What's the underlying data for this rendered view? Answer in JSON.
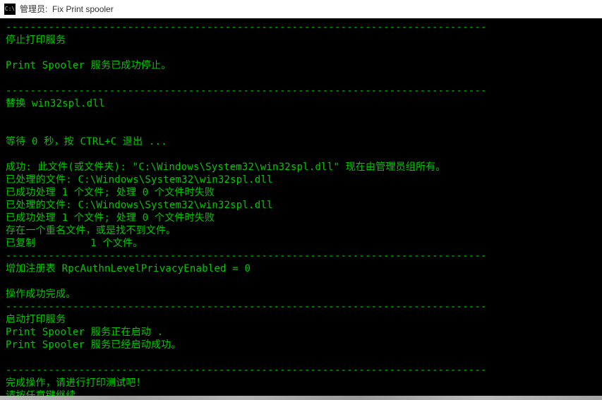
{
  "titlebar": {
    "icon_label": "C:\\",
    "title": "管理员:  Fix Print spooler"
  },
  "console": {
    "lines": [
      "-------------------------------------------------------------------------------",
      "停止打印服务",
      "",
      "Print Spooler 服务已成功停止。",
      "",
      "-------------------------------------------------------------------------------",
      "替换 win32spl.dll",
      "",
      "",
      "等待 0 秒，按 CTRL+C 退出 ...",
      "",
      "成功: 此文件(或文件夹): \"C:\\Windows\\System32\\win32spl.dll\" 现在由管理员组所有。",
      "已处理的文件: C:\\Windows\\System32\\win32spl.dll",
      "已成功处理 1 个文件; 处理 0 个文件时失败",
      "已处理的文件: C:\\Windows\\System32\\win32spl.dll",
      "已成功处理 1 个文件; 处理 0 个文件时失败",
      "存在一个重名文件，或是找不到文件。",
      "已复制         1 个文件。",
      "-------------------------------------------------------------------------------",
      "增加注册表 RpcAuthnLevelPrivacyEnabled = 0",
      "",
      "操作成功完成。",
      "-------------------------------------------------------------------------------",
      "启动打印服务",
      "Print Spooler 服务正在启动 .",
      "Print Spooler 服务已经启动成功。",
      "",
      "-------------------------------------------------------------------------------",
      "完成操作，请进行打印测试吧！",
      "请按任意键继续. . ."
    ]
  }
}
